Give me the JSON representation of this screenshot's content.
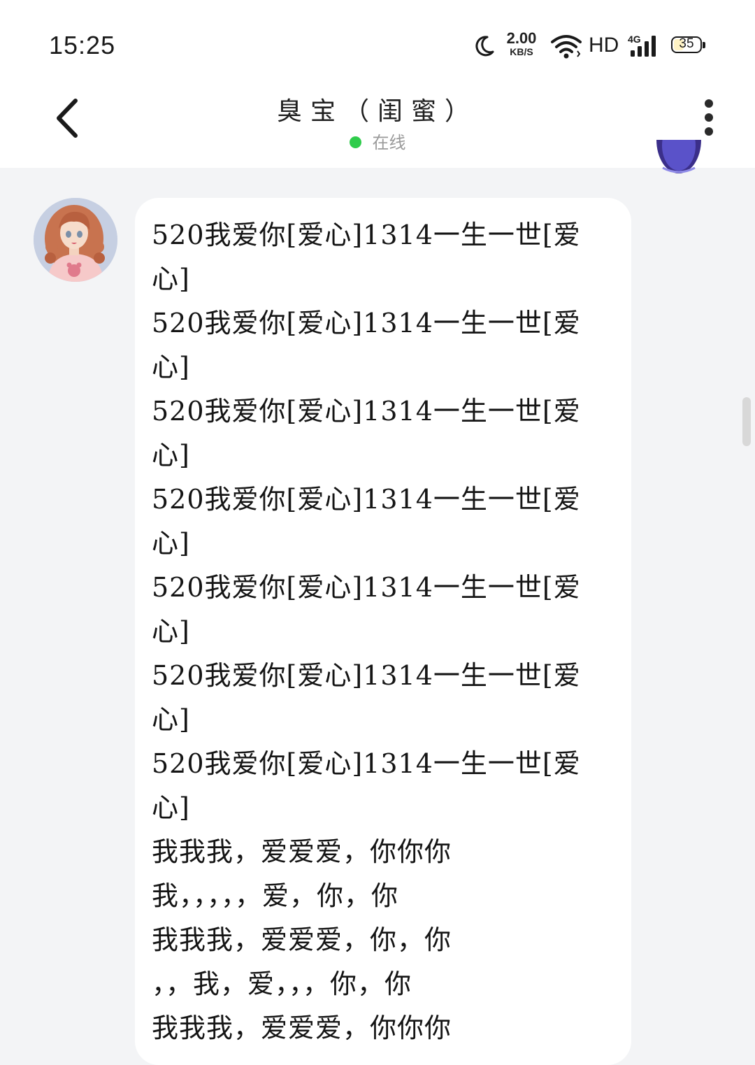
{
  "status_bar": {
    "time": "15:25",
    "net_speed": "2.00",
    "net_speed_unit": "KB/S",
    "hd": "HD",
    "network_type": "4G",
    "battery_level": "35",
    "icons": [
      "moon-icon",
      "wifi-icon",
      "signal-icon",
      "battery-icon"
    ]
  },
  "header": {
    "title": "臭宝（闺蜜）",
    "presence": "在线",
    "presence_color": "#2fcc4b",
    "back_icon": "chevron-left-icon",
    "more_icon": "more-vertical-icon"
  },
  "chat": {
    "message_lines": [
      "520我爱你[爱心]1314一生一世[爱",
      "心]",
      "520我爱你[爱心]1314一生一世[爱",
      "心]",
      "520我爱你[爱心]1314一生一世[爱",
      "心]",
      "520我爱你[爱心]1314一生一世[爱",
      "心]",
      "520我爱你[爱心]1314一生一世[爱",
      "心]",
      "520我爱你[爱心]1314一生一世[爱",
      "心]",
      "520我爱你[爱心]1314一生一世[爱",
      "心]",
      "我我我，爱爱爱，你你你",
      "我，，，，，爱，你，你",
      "我我我，爱爱爱，你，你",
      "，，我，爱，，，你，你",
      "我我我，爱爱爱，你你你"
    ]
  }
}
